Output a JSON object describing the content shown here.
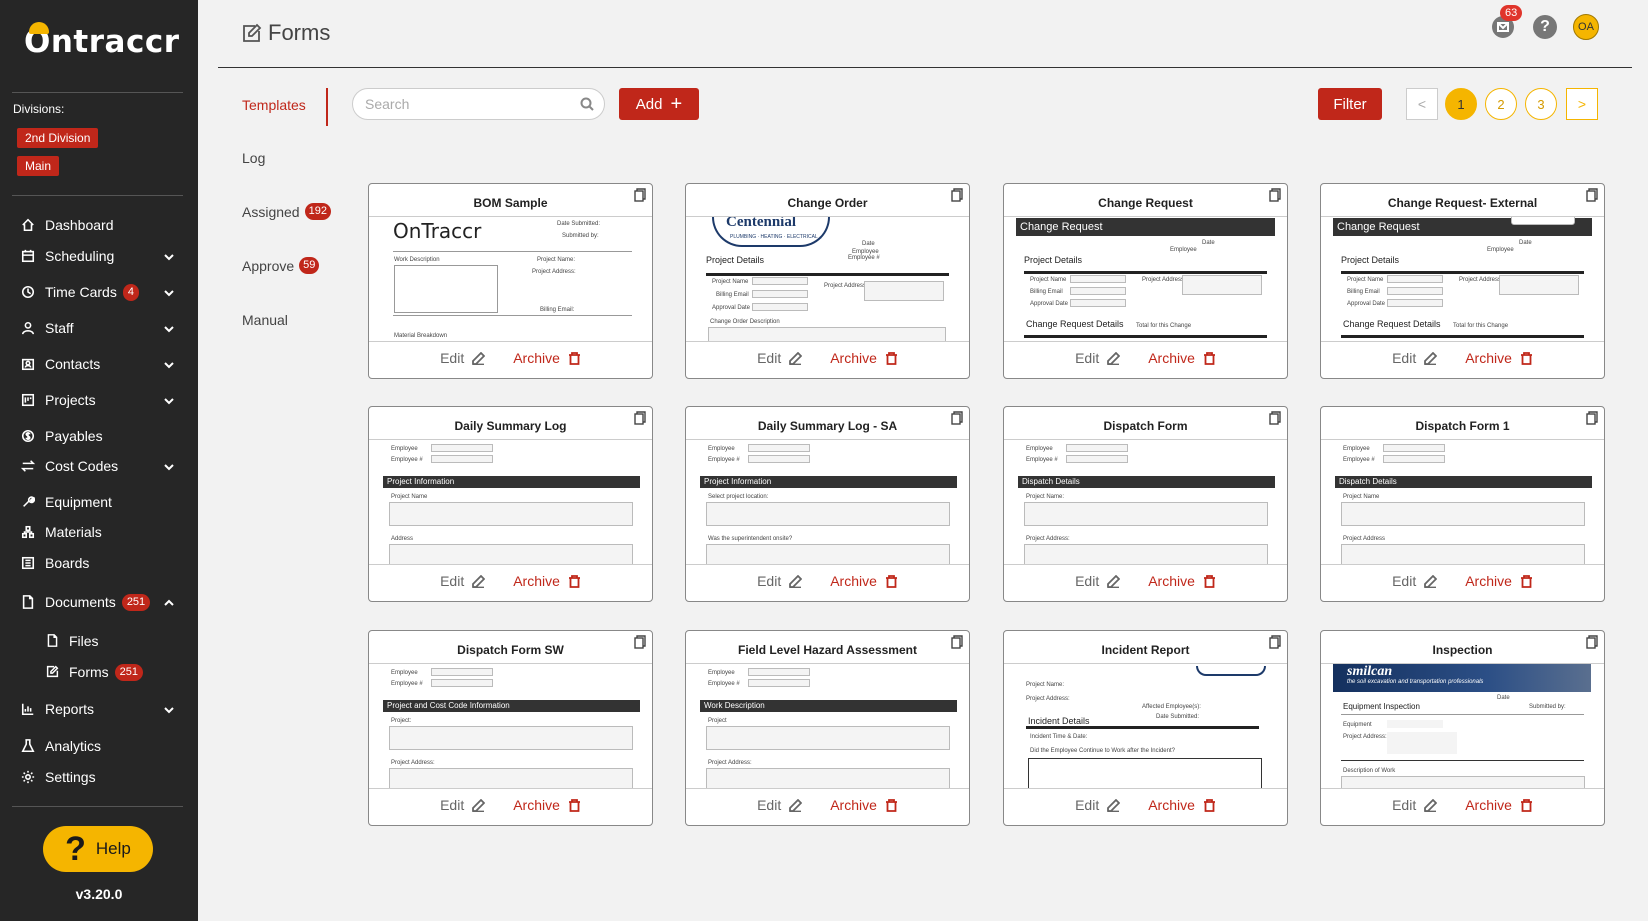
{
  "app": {
    "logo_text": "Ontraccr",
    "version": "v3.20.0",
    "help_label": "Help"
  },
  "sidebar": {
    "divisions_label": "Divisions:",
    "divisions": [
      "2nd Division",
      "Main"
    ],
    "items": [
      {
        "label": "Dashboard",
        "icon": "home-icon"
      },
      {
        "label": "Scheduling",
        "icon": "calendar-icon",
        "expandable": true
      },
      {
        "label": "Time Cards",
        "icon": "clock-icon",
        "badge": "4",
        "expandable": true
      },
      {
        "label": "Staff",
        "icon": "user-icon",
        "expandable": true
      },
      {
        "label": "Contacts",
        "icon": "contacts-icon",
        "expandable": true
      },
      {
        "label": "Projects",
        "icon": "projects-icon",
        "expandable": true
      },
      {
        "label": "Payables",
        "icon": "dollar-icon"
      },
      {
        "label": "Cost Codes",
        "icon": "swap-icon",
        "expandable": true
      },
      {
        "label": "Equipment",
        "icon": "wrench-icon"
      },
      {
        "label": "Materials",
        "icon": "materials-icon"
      },
      {
        "label": "Boards",
        "icon": "board-icon"
      },
      {
        "label": "Documents",
        "icon": "document-icon",
        "badge": "251",
        "expanded": true
      },
      {
        "label": "Reports",
        "icon": "chart-icon",
        "expandable": true
      },
      {
        "label": "Analytics",
        "icon": "flask-icon"
      },
      {
        "label": "Settings",
        "icon": "gear-icon"
      }
    ],
    "documents_sub": [
      {
        "label": "Files",
        "icon": "file-icon"
      },
      {
        "label": "Forms",
        "icon": "form-icon",
        "badge": "251"
      }
    ]
  },
  "header": {
    "title": "Forms",
    "mail_badge": "63",
    "avatar_initials": "OA"
  },
  "tabs": [
    {
      "label": "Templates",
      "active": true
    },
    {
      "label": "Log"
    },
    {
      "label": "Assigned",
      "badge": "192"
    },
    {
      "label": "Approve",
      "badge": "59"
    },
    {
      "label": "Manual"
    }
  ],
  "toolbar": {
    "search_placeholder": "Search",
    "search_value": "",
    "add_label": "Add",
    "filter_label": "Filter",
    "pages": [
      "1",
      "2",
      "3"
    ],
    "current_page": "1",
    "prev_glyph": "<",
    "next_glyph": ">"
  },
  "card_actions": {
    "edit": "Edit",
    "archive": "Archive"
  },
  "cards": [
    {
      "title": "BOM Sample",
      "preview": {
        "logo": "OnTraccr",
        "fields": [
          "Date Submitted:",
          "Submitted by:",
          "Work Description",
          "Project Name:",
          "Project Address:",
          "Billing Email:",
          "Material Breakdown"
        ]
      }
    },
    {
      "title": "Change Order",
      "preview": {
        "logo": "Centennial",
        "logo_sub": "PLUMBING · HEATING · ELECTRICAL",
        "section": "Project Details",
        "fields": [
          "Date",
          "Employee",
          "Employee #",
          "Project Name",
          "Billing Email",
          "Approval Date",
          "Project Address",
          "Change Order Description"
        ]
      }
    },
    {
      "title": "Change Request",
      "preview": {
        "bar": "Change Request",
        "section": "Project Details",
        "section2": "Change Request Details",
        "fields": [
          "Date",
          "Employee",
          "Project Name",
          "Billing Email",
          "Approval Date",
          "Project Address",
          "Total for this Change"
        ]
      }
    },
    {
      "title": "Change Request- External",
      "preview": {
        "bar": "Change Request",
        "section": "Project Details",
        "section2": "Change Request Details",
        "fields": [
          "Date",
          "Employee",
          "Project Name",
          "Billing Email",
          "Approval Date",
          "Project Address",
          "Total for this Change"
        ]
      }
    },
    {
      "title": "Daily Summary Log",
      "preview": {
        "bar": "Project Information",
        "fields": [
          "Employee",
          "Employee #",
          "Project Name",
          "Address"
        ]
      }
    },
    {
      "title": "Daily Summary Log - SA",
      "preview": {
        "bar": "Project Information",
        "fields": [
          "Employee",
          "Employee #",
          "Select project location:",
          "Was the superintendent onsite?"
        ]
      }
    },
    {
      "title": "Dispatch Form",
      "preview": {
        "bar": "Dispatch Details",
        "fields": [
          "Employee",
          "Employee #",
          "Project Name:",
          "Project Address:"
        ]
      }
    },
    {
      "title": "Dispatch Form 1",
      "preview": {
        "bar": "Dispatch Details",
        "fields": [
          "Employee",
          "Employee #",
          "Project Name",
          "Project Address"
        ]
      }
    },
    {
      "title": "Dispatch Form SW",
      "preview": {
        "bar": "Project and Cost Code Information",
        "fields": [
          "Employee",
          "Employee #",
          "Project:",
          "Project Address:"
        ]
      }
    },
    {
      "title": "Field Level Hazard Assessment",
      "preview": {
        "bar": "Work Description",
        "fields": [
          "Employee",
          "Employee #",
          "Project",
          "Project Address:"
        ]
      }
    },
    {
      "title": "Incident Report",
      "preview": {
        "section": "Incident Details",
        "fields": [
          "Project Name:",
          "Project Address:",
          "Affected Employee(s):",
          "Date Submitted:",
          "Incident Time & Date:",
          "Did the Employee Continue to Work after the Incident?"
        ]
      }
    },
    {
      "title": "Inspection",
      "preview": {
        "banner": "smilcan",
        "banner_sub": "the soil excavation and transportation professionals",
        "section": "Equipment Inspection",
        "fields": [
          "Date",
          "Submitted by:",
          "Equipment",
          "Project Address:",
          "Description of Work"
        ]
      }
    }
  ],
  "colors": {
    "accent": "#c0271a",
    "brand_yellow": "#f5b500",
    "sidebar_bg": "#262626",
    "page_bg": "#f2f2f2"
  }
}
